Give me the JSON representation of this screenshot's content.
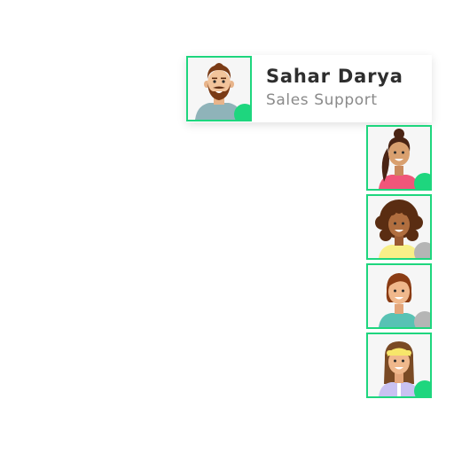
{
  "active_contact": {
    "name": "Sahar Darya",
    "role": "Sales Support",
    "avatar_icon": "bearded-man-avatar",
    "status": "online"
  },
  "contacts": [
    {
      "avatar_icon": "ponytail-woman-avatar",
      "status": "online"
    },
    {
      "avatar_icon": "curly-hair-woman-avatar",
      "status": "away"
    },
    {
      "avatar_icon": "short-hair-woman-avatar",
      "status": "away"
    },
    {
      "avatar_icon": "headband-woman-avatar",
      "status": "online"
    }
  ],
  "colors": {
    "accent": "#1ed67e",
    "online": "#1ed67e",
    "away": "#b5b5b5",
    "name_text": "#2e2e2e",
    "role_text": "#8a8a8a"
  }
}
